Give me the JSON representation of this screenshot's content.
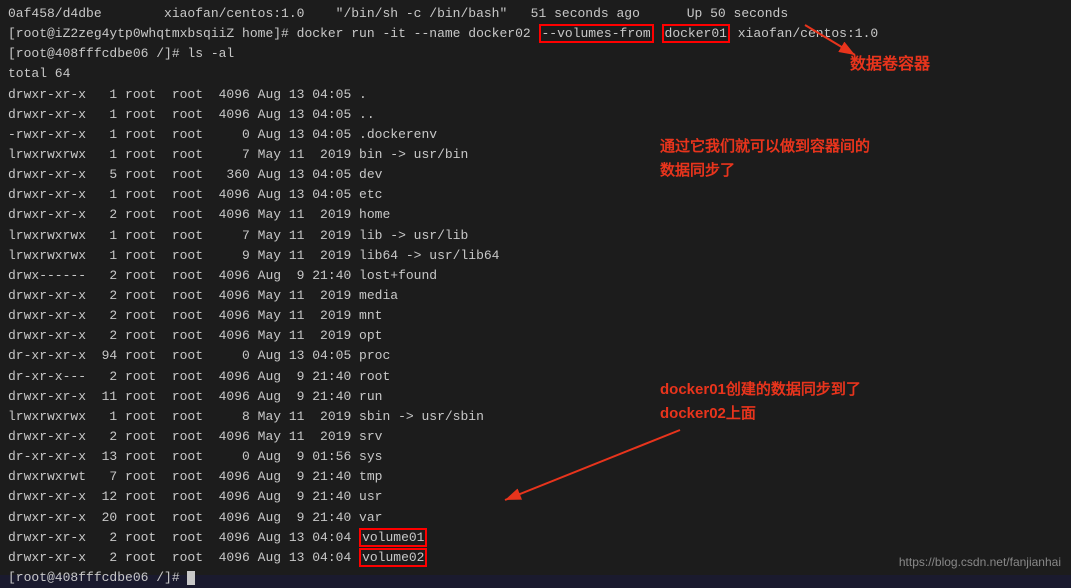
{
  "terminal": {
    "lines": [
      {
        "id": "l1",
        "text": "0af458/d4dbe        xiaofan/centos:1.0    \"/bin/sh -c /bin/bash\"   51 seconds ago      Up 50 seconds",
        "highlight": null
      },
      {
        "id": "l2",
        "text": "[root@iZ2zeg4ytp0whqtmxbsqiiZ home]# docker run -it --name docker02 ",
        "highlight_before": "",
        "highlight_volumes": "--volumes-from",
        "highlight_space": " ",
        "highlight_docker01": "docker01",
        "highlight_after": " xiaofan/centos:1.0"
      },
      {
        "id": "l3",
        "text": "[root@408fffcdbe06 /]# ls -al"
      },
      {
        "id": "l4",
        "text": "total 64"
      },
      {
        "id": "l5",
        "text": "drwxr-xr-x   1 root  root  4096 Aug 13 04:05 ."
      },
      {
        "id": "l6",
        "text": "drwxr-xr-x   1 root  root  4096 Aug 13 04:05 .."
      },
      {
        "id": "l7",
        "text": "-rwxr-xr-x   1 root  root     0 Aug 13 04:05 .dockerenv"
      },
      {
        "id": "l8",
        "text": "lrwxrwxrwx   1 root  root     7 May 11  2019 bin -> usr/bin"
      },
      {
        "id": "l9",
        "text": "drwxr-xr-x   5 root  root   360 Aug 13 04:05 dev"
      },
      {
        "id": "l10",
        "text": "drwxr-xr-x   1 root  root  4096 Aug 13 04:05 etc"
      },
      {
        "id": "l11",
        "text": "drwxr-xr-x   2 root  root  4096 May 11  2019 home"
      },
      {
        "id": "l12",
        "text": "lrwxrwxrwx   1 root  root     7 May 11  2019 lib -> usr/lib"
      },
      {
        "id": "l13",
        "text": "lrwxrwxrwx   1 root  root     9 May 11  2019 lib64 -> usr/lib64"
      },
      {
        "id": "l14",
        "text": "drwx------   2 root  root  4096 Aug  9 21:40 lost+found"
      },
      {
        "id": "l15",
        "text": "drwxr-xr-x   2 root  root  4096 May 11  2019 media"
      },
      {
        "id": "l16",
        "text": "drwxr-xr-x   2 root  root  4096 May 11  2019 mnt"
      },
      {
        "id": "l17",
        "text": "drwxr-xr-x   2 root  root  4096 May 11  2019 opt"
      },
      {
        "id": "l18",
        "text": "dr-xr-xr-x  94 root  root     0 Aug 13 04:05 proc"
      },
      {
        "id": "l19",
        "text": "dr-xr-x---   2 root  root  4096 Aug  9 21:40 root"
      },
      {
        "id": "l20",
        "text": "drwxr-xr-x  11 root  root  4096 Aug  9 21:40 run"
      },
      {
        "id": "l21",
        "text": "lrwxrwxrwx   1 root  root     8 May 11  2019 sbin -> usr/sbin"
      },
      {
        "id": "l22",
        "text": "drwxr-xr-x   2 root  root  4096 May 11  2019 srv"
      },
      {
        "id": "l23",
        "text": "dr-xr-xr-x  13 root  root     0 Aug  9 01:56 sys"
      },
      {
        "id": "l24",
        "text": "drwxrwxrwt   7 root  root  4096 Aug  9 21:40 tmp"
      },
      {
        "id": "l25",
        "text": "drwxr-xr-x  12 root  root  4096 Aug  9 21:40 usr"
      },
      {
        "id": "l26",
        "text": "drwxr-xr-x  20 root  root  4096 Aug  9 21:40 var"
      },
      {
        "id": "l27",
        "text": "drwxr-xr-x   2 root  root  4096 Aug 13 04:04 volume01",
        "highlight_end": "volume01"
      },
      {
        "id": "l28",
        "text": "drwxr-xr-x   2 root  root  4096 Aug 13 04:04 volume02",
        "highlight_end": "volume02"
      },
      {
        "id": "l29",
        "text": "[root@408fffcdbe06 /]# ",
        "cursor": true
      }
    ]
  },
  "annotations": {
    "data_volume_container": "数据卷容器",
    "sync_description": "通过它我们就可以做到容器间的\n数据同步了",
    "docker01_sync": "docker01创建的数据同步到了\ndocker02上面"
  },
  "footer": {
    "link": "https://blog.csdn.net/fanjianhai"
  }
}
